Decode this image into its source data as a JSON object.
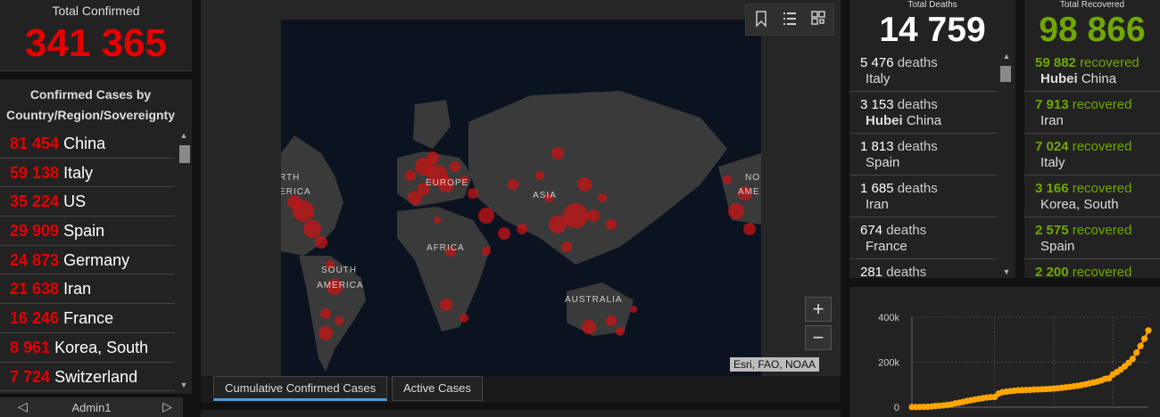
{
  "total_confirmed": {
    "label": "Total Confirmed",
    "value": "341 365"
  },
  "confirmed_list": {
    "header": "Confirmed Cases by Country/Region/Sovereignty",
    "items": [
      {
        "count": "81 454",
        "country": "China"
      },
      {
        "count": "59 138",
        "country": "Italy"
      },
      {
        "count": "35 224",
        "country": "US"
      },
      {
        "count": "29 909",
        "country": "Spain"
      },
      {
        "count": "24 873",
        "country": "Germany"
      },
      {
        "count": "21 638",
        "country": "Iran"
      },
      {
        "count": "16 246",
        "country": "France"
      },
      {
        "count": "8 961",
        "country": "Korea, South"
      },
      {
        "count": "7 724",
        "country": "Switzerland"
      }
    ]
  },
  "admin_nav": {
    "label": "Admin1",
    "prev": "◁",
    "next": "▷"
  },
  "map": {
    "labels": [
      "EUROPE",
      "ASIA",
      "AFRICA",
      "SOUTH",
      "AMERICA",
      "AUSTRALIA",
      "RTH",
      "ERICA",
      "NO",
      "AME"
    ],
    "attribution": "Esri, FAO, NOAA",
    "tools": [
      "bookmark-icon",
      "list-icon",
      "qr-icon"
    ],
    "zoom_in": "+",
    "zoom_out": "−",
    "tabs": [
      "Cumulative Confirmed Cases",
      "Active Cases"
    ]
  },
  "deaths": {
    "label": "Total Deaths",
    "value": "14 759",
    "suffix": "deaths",
    "items": [
      {
        "count": "5 476",
        "region": "",
        "country": "Italy"
      },
      {
        "count": "3 153",
        "region": "Hubei",
        "country": "China"
      },
      {
        "count": "1 813",
        "region": "",
        "country": "Spain"
      },
      {
        "count": "1 685",
        "region": "",
        "country": "Iran"
      },
      {
        "count": "674",
        "region": "",
        "country": "France"
      },
      {
        "count": "281",
        "region": "",
        "country": ""
      }
    ]
  },
  "recovered": {
    "label": "Total Recovered",
    "value": "98 866",
    "suffix": "recovered",
    "items": [
      {
        "count": "59 882",
        "region": "Hubei",
        "country": "China"
      },
      {
        "count": "7 913",
        "region": "",
        "country": "Iran"
      },
      {
        "count": "7 024",
        "region": "",
        "country": "Italy"
      },
      {
        "count": "3 166",
        "region": "",
        "country": "Korea, South"
      },
      {
        "count": "2 575",
        "region": "",
        "country": "Spain"
      },
      {
        "count": "2 200",
        "region": "",
        "country": ""
      }
    ]
  },
  "colors": {
    "confirmed": "#e60000",
    "recovered": "#70a800",
    "chart": "#ffa500"
  },
  "chart_data": {
    "type": "line",
    "title": "",
    "xlabel": "",
    "ylabel": "",
    "yticks": [
      "0",
      "200k",
      "400k"
    ],
    "ylim": [
      0,
      400000
    ],
    "series": [
      {
        "values": [
          555,
          654,
          941,
          1434,
          2118,
          2927,
          5578,
          6166,
          8234,
          9927,
          12038,
          16787,
          19881,
          23892,
          27635,
          30794,
          34391,
          37120,
          40150,
          42762,
          44802,
          45221,
          60368,
          66885,
          69030,
          71224,
          73258,
          75136,
          75639,
          76197,
          76819,
          78572,
          78958,
          79561,
          80406,
          81388,
          82746,
          84112,
          86011,
          88369,
          90306,
          92840,
          95120,
          97886,
          101800,
          105847,
          109821,
          113590,
          118620,
          125875,
          128352,
          145205,
          156101,
          167454,
          181574,
          197102,
          214821,
          242570,
          272208,
          304507,
          341365
        ]
      }
    ]
  }
}
